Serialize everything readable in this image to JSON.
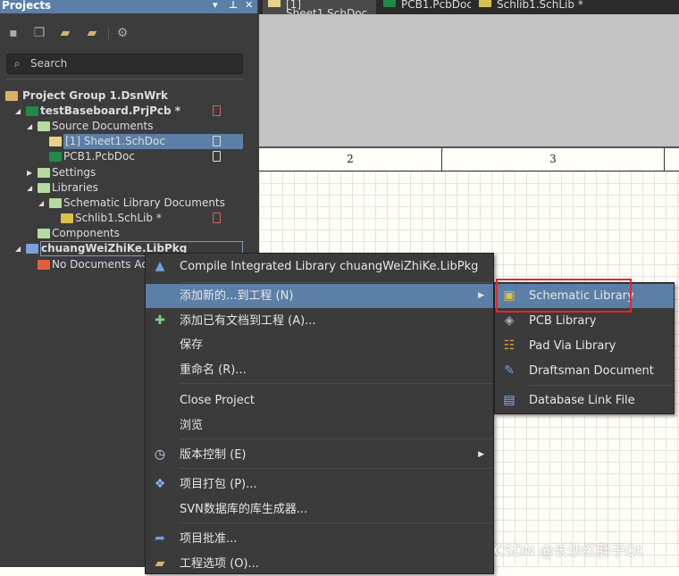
{
  "panel": {
    "title": "Projects",
    "controls": [
      "▾",
      "⊥",
      "✕"
    ],
    "toolbar": [
      "save-icon",
      "copy-icon",
      "folder-search-icon",
      "folder-settings-icon",
      "gear-icon"
    ],
    "search_placeholder": "Search",
    "tree": [
      {
        "label": "Project Group 1.DsnWrk",
        "indent": 0,
        "icon": "project-group-icon",
        "bold": true
      },
      {
        "label": "testBaseboard.PrjPcb *",
        "indent": 1,
        "icon": "pcb-project-icon",
        "bold": true,
        "expanded": true,
        "status": "modified"
      },
      {
        "label": "Source Documents",
        "indent": 2,
        "icon": "folder-icon",
        "expanded": true
      },
      {
        "label": "[1] Sheet1.SchDoc",
        "indent": 3,
        "icon": "schdoc-icon",
        "selected": true,
        "status": "saved"
      },
      {
        "label": "PCB1.PcbDoc",
        "indent": 3,
        "icon": "pcbdoc-icon",
        "status": "saved"
      },
      {
        "label": "Settings",
        "indent": 2,
        "icon": "folder-icon",
        "expanded": false
      },
      {
        "label": "Libraries",
        "indent": 2,
        "icon": "folder-icon",
        "expanded": true
      },
      {
        "label": "Schematic Library Documents",
        "indent": 3,
        "icon": "folder-icon",
        "expanded": true
      },
      {
        "label": "Schlib1.SchLib *",
        "indent": 4,
        "icon": "schlib-icon",
        "status": "modified"
      },
      {
        "label": "Components",
        "indent": 2,
        "icon": "folder-icon"
      },
      {
        "label": "chuangWeiZhiKe.LibPkg",
        "indent": 1,
        "icon": "libpkg-icon",
        "bold": true,
        "expanded": true,
        "focused": true
      },
      {
        "label": "No Documents Added",
        "indent": 2,
        "icon": "red-folder-icon"
      }
    ]
  },
  "tabs": [
    {
      "label": "[1] Sheet1.SchDoc",
      "active": true
    },
    {
      "label": "PCB1.PcbDoc"
    },
    {
      "label": "Schlib1.SchLib *"
    }
  ],
  "ruler": [
    "2",
    "3"
  ],
  "context_menu": [
    {
      "label": "Compile Integrated Library chuangWeiZhiKe.LibPkg",
      "icon": "compile-icon"
    },
    {
      "sep": true
    },
    {
      "label": "添加新的...到工程 (N)",
      "highlighted": true,
      "submenu": true
    },
    {
      "label": "添加已有文档到工程 (A)...",
      "icon": "add-existing-icon"
    },
    {
      "label": "保存"
    },
    {
      "label": "重命名 (R)..."
    },
    {
      "sep": true
    },
    {
      "label": "Close Project"
    },
    {
      "label": "浏览"
    },
    {
      "sep": true
    },
    {
      "label": "版本控制 (E)",
      "icon": "clock-icon",
      "submenu": true
    },
    {
      "sep": true
    },
    {
      "label": "项目打包 (P)...",
      "icon": "dropbox-icon"
    },
    {
      "label": "SVN数据库的库生成器..."
    },
    {
      "sep": true
    },
    {
      "label": "项目批准...",
      "icon": "share-arrow-icon"
    },
    {
      "label": "工程选项 (O)...",
      "icon": "folder-options-icon"
    }
  ],
  "submenu": [
    {
      "label": "Schematic Library",
      "icon": "schlib-icon",
      "highlighted": true
    },
    {
      "label": "PCB Library",
      "icon": "pcblib-icon"
    },
    {
      "label": "Pad Via Library",
      "icon": "padvia-icon"
    },
    {
      "label": "Draftsman Document",
      "icon": "draftsman-icon"
    },
    {
      "sep": true
    },
    {
      "label": "Database Link File",
      "icon": "database-icon"
    }
  ],
  "watermark": "CSDN @长沙红胖子Qt",
  "colors": {
    "highlight": "#5b7fa6",
    "annotation": "#e8262b",
    "panel": "#3c3c3c"
  }
}
